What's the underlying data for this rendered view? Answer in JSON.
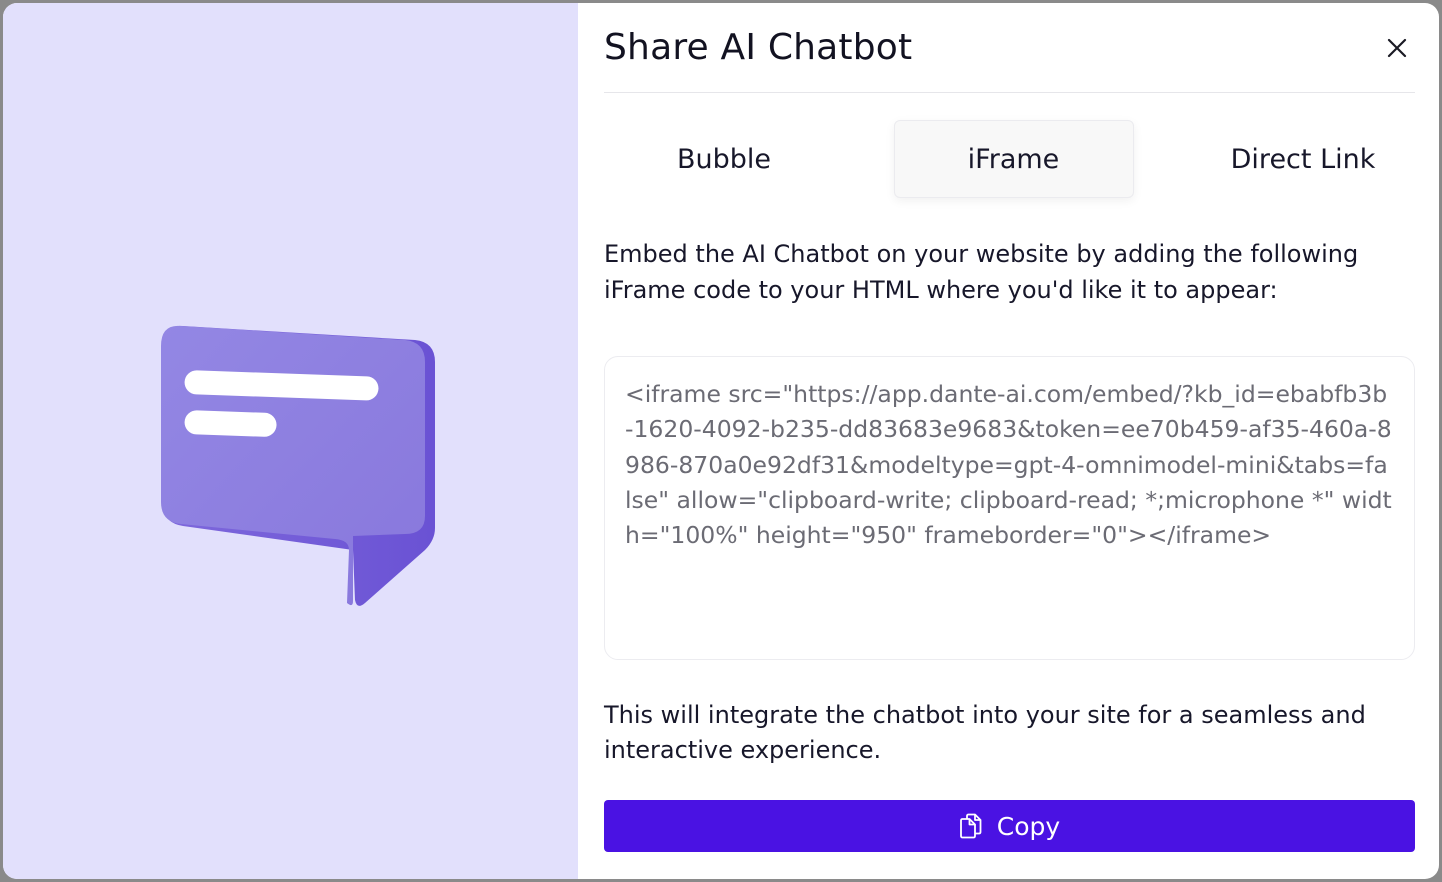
{
  "modal": {
    "title": "Share AI Chatbot",
    "close_icon": "close-icon"
  },
  "illustration": {
    "icon": "chat-bubble-illustration",
    "colors": {
      "panel_background": "#e2e0fc",
      "bubble": "#8e7fe0"
    }
  },
  "tabs": [
    {
      "label": "Bubble",
      "active": false
    },
    {
      "label": "iFrame",
      "active": true
    },
    {
      "label": "Direct Link",
      "active": false
    }
  ],
  "description": "Embed the AI Chatbot on your website by adding the following iFrame code to your HTML where you'd like it to appear:",
  "embed_code": "<iframe src=\"https://app.dante-ai.com/embed/?kb_id=ebabfb3b-1620-4092-b235-dd83683e9683&token=ee70b459-af35-460a-8986-870a0e92df31&modeltype=gpt-4-omnimodel-mini&tabs=false\" allow=\"clipboard-write; clipboard-read; *;microphone *\" width=\"100%\" height=\"950\" frameborder=\"0\"></iframe>",
  "note": "This will integrate the chatbot into your site for a seamless and interactive experience.",
  "copy_button": {
    "label": "Copy",
    "icon": "copy-icon",
    "color": "#4a12e3"
  }
}
